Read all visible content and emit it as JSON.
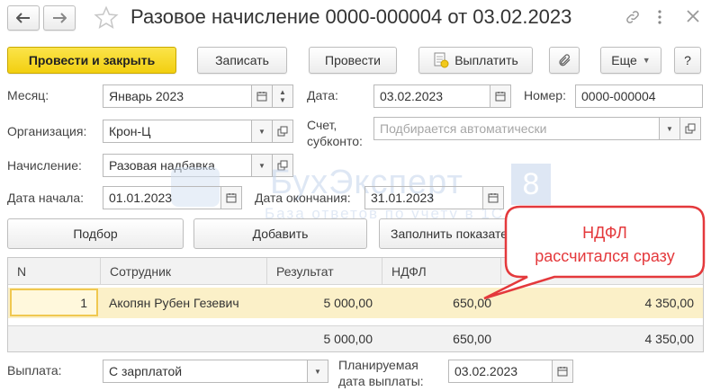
{
  "window": {
    "title": "Разовое начисление 0000-000004 от 03.02.2023",
    "icons": [
      "arrow-left-icon",
      "arrow-right-icon",
      "star-icon",
      "link-icon",
      "more-vertical-icon",
      "close-icon"
    ]
  },
  "toolbar": {
    "post_close": "Провести и закрыть",
    "save": "Записать",
    "post": "Провести",
    "pay": "Выплатить",
    "more": "Еще",
    "help": "?"
  },
  "form": {
    "month_label": "Месяц:",
    "month_value": "Январь 2023",
    "date_label": "Дата:",
    "date_value": "03.02.2023",
    "number_label": "Номер:",
    "number_value": "0000-000004",
    "org_label": "Организация:",
    "org_value": "Крон-Ц",
    "account_label_1": "Счет,",
    "account_label_2": "субконто:",
    "account_placeholder": "Подбирается автоматически",
    "accrual_label": "Начисление:",
    "accrual_value": "Разовая надбавка",
    "start_label": "Дата начала:",
    "start_value": "01.01.2023",
    "end_label": "Дата окончания:",
    "end_value": "31.01.2023"
  },
  "actions": {
    "select": "Подбор",
    "add": "Добавить",
    "fill": "Заполнить показатели"
  },
  "table": {
    "headers": [
      "N",
      "Сотрудник",
      "Результат",
      "НДФЛ",
      ""
    ],
    "rows": [
      {
        "n": "1",
        "employee": "Акопян Рубен Гезевич",
        "result": "5 000,00",
        "ndfl": "650,00",
        "payout": "4 350,00"
      }
    ],
    "totals": {
      "result": "5 000,00",
      "ndfl": "650,00",
      "payout": "4 350,00"
    }
  },
  "footer": {
    "payment_label": "Выплата:",
    "payment_value": "С зарплатой",
    "planned_label_1": "Планируемая",
    "planned_label_2": "дата выплаты:",
    "planned_value": "03.02.2023"
  },
  "callout": {
    "line1": "НДФЛ",
    "line2": "рассчитался сразу"
  },
  "watermark": {
    "brand": "БухЭксперт",
    "digit": "8",
    "tagline": "База ответов по учету в 1С"
  },
  "colors": {
    "primary_yellow": "#f5d41e",
    "selected_row": "#fbf0c8",
    "callout_red": "#e4393c",
    "watermark_blue": "#b9cde8"
  }
}
